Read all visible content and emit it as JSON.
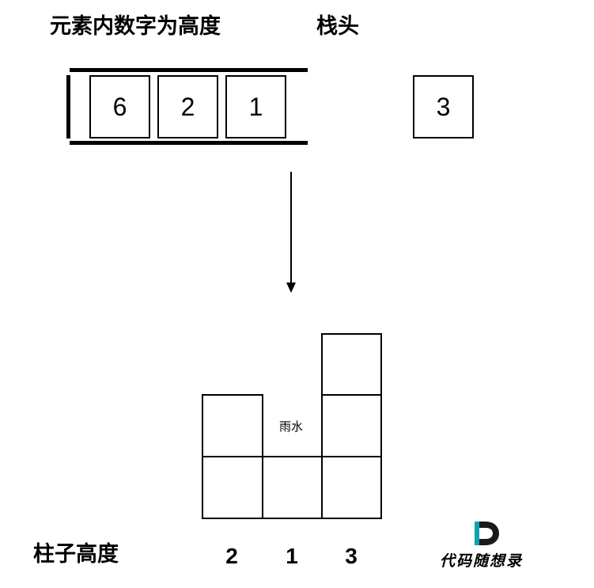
{
  "labels": {
    "element_value_caption": "元素内数字为高度",
    "stack_top_caption": "栈头",
    "column_height_caption": "柱子高度",
    "rain_label": "雨水"
  },
  "stack": {
    "elements": [
      "6",
      "2",
      "1"
    ],
    "top_value": "3"
  },
  "columns": {
    "heights": [
      "2",
      "1",
      "3"
    ]
  },
  "logo": {
    "letter": "D",
    "text": "代码随想录"
  }
}
